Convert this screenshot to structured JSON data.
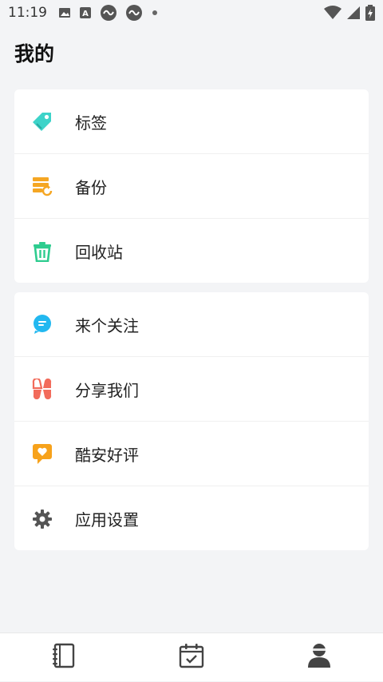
{
  "status_bar": {
    "time": "11:19",
    "icons": [
      "image-icon",
      "text-icon",
      "infinity-icon",
      "infinity-icon",
      "dot-icon"
    ],
    "right_icons": [
      "wifi-icon",
      "signal-icon",
      "battery-icon"
    ]
  },
  "page": {
    "title": "我的"
  },
  "menu_group_1": [
    {
      "label": "标签",
      "icon": "tag-icon",
      "color": "#3dd3c9"
    },
    {
      "label": "备份",
      "icon": "backup-icon",
      "color": "#f5a623"
    },
    {
      "label": "回收站",
      "icon": "trash-icon",
      "color": "#2ecc8f"
    }
  ],
  "menu_group_2": [
    {
      "label": "来个关注",
      "icon": "chat-icon",
      "color": "#22b8f0"
    },
    {
      "label": "分享我们",
      "icon": "share-icon",
      "color": "#f26b5b"
    },
    {
      "label": "酷安好评",
      "icon": "heart-message-icon",
      "color": "#f7a21b"
    },
    {
      "label": "应用设置",
      "icon": "gear-icon",
      "color": "#555555"
    }
  ],
  "bottom_nav": {
    "items": [
      {
        "icon": "notebook-icon"
      },
      {
        "icon": "calendar-check-icon"
      },
      {
        "icon": "user-icon",
        "active": true
      }
    ]
  }
}
